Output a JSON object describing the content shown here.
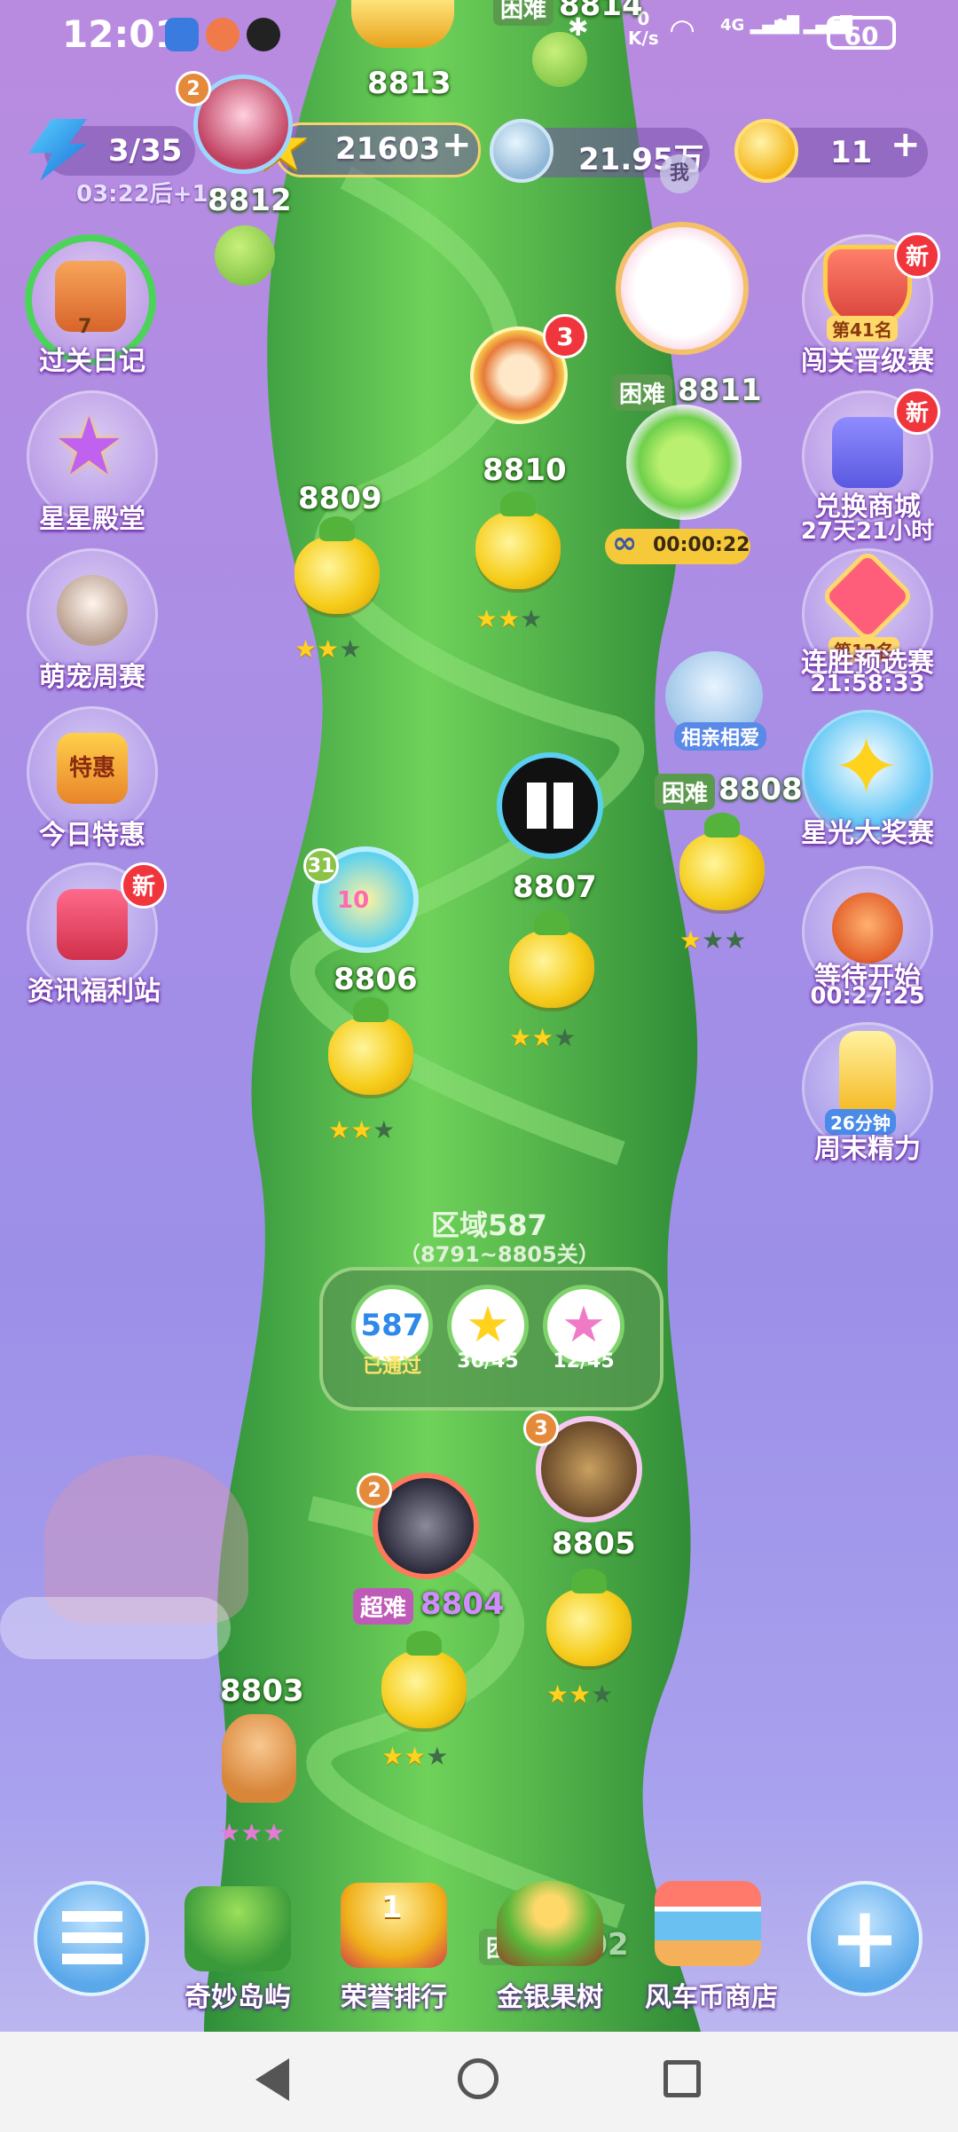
{
  "status": {
    "time": "12:01",
    "net_speed_top": "0",
    "net_speed_unit": "K/s",
    "net1": "4G",
    "net2": "4G",
    "battery": "60"
  },
  "top_level": {
    "partial_number": "8814",
    "partial_tag": "困难"
  },
  "resources": {
    "lives": "3/35",
    "lives_timer": "03:22后+1",
    "stars": "21603",
    "coins": "21.95万",
    "tokens": "11",
    "me_label": "我",
    "plus": "+"
  },
  "avatar_badge": "2",
  "side_left": [
    {
      "label": "过关日记",
      "sub": "7"
    },
    {
      "label": "星星殿堂"
    },
    {
      "label": "萌宠周赛"
    },
    {
      "label": "今日特惠",
      "art_text": "特惠"
    },
    {
      "label": "资讯福利站",
      "badge": "新"
    }
  ],
  "side_right": [
    {
      "label": "闯关晋级赛",
      "badge": "新",
      "rank": "第41名"
    },
    {
      "label": "兑换商城",
      "badge": "新",
      "sub": "27天21小时"
    },
    {
      "label": "连胜预选赛",
      "rank": "第12名",
      "sub": "21:58:33"
    },
    {
      "label": "星光大奖赛"
    },
    {
      "label": "等待开始",
      "sub": "00:27:25"
    },
    {
      "label": "周末精力",
      "art_text": "26分钟"
    }
  ],
  "levels": [
    {
      "num": "8813"
    },
    {
      "num": "8812"
    },
    {
      "num": "8811",
      "tag": "困难",
      "timer": "00:00:22"
    },
    {
      "num": "8810",
      "badge": "3"
    },
    {
      "num": "8809",
      "stars": 2
    },
    {
      "num": "8808",
      "tag": "困难",
      "stars": 1,
      "label_text": "相亲相爱",
      "ten": "10"
    },
    {
      "num": "8807",
      "stars": 2
    },
    {
      "num": "8806",
      "stars": 2,
      "badge": "31",
      "ten": "10"
    },
    {
      "num": "8805",
      "stars": 2,
      "badge": "3"
    },
    {
      "num": "8804",
      "tag": "超难",
      "stars": 2,
      "badge": "2"
    },
    {
      "num": "8803",
      "stars": 3
    }
  ],
  "level_8810_stars": 2,
  "region": {
    "title": "区域587",
    "range": "（8791~8805关）",
    "number": "587",
    "passed": "已通过",
    "stars_count": "36/45",
    "rainbow_count": "12/45"
  },
  "bottom_nav": {
    "left_icon": "list-icon",
    "right_icon": "plus-icon",
    "items": [
      "奇妙岛屿",
      "荣誉排行",
      "金银果树",
      "风车币商店"
    ],
    "honor_rank": "1",
    "behind_tag": "困难",
    "behind_num": "8802"
  },
  "colors": {
    "bg_top": "#b98be0",
    "bg_bottom": "#c4bff0",
    "stalk": "#4cb84a",
    "gold": "#ffd21e",
    "new_red": "#f0353d"
  }
}
